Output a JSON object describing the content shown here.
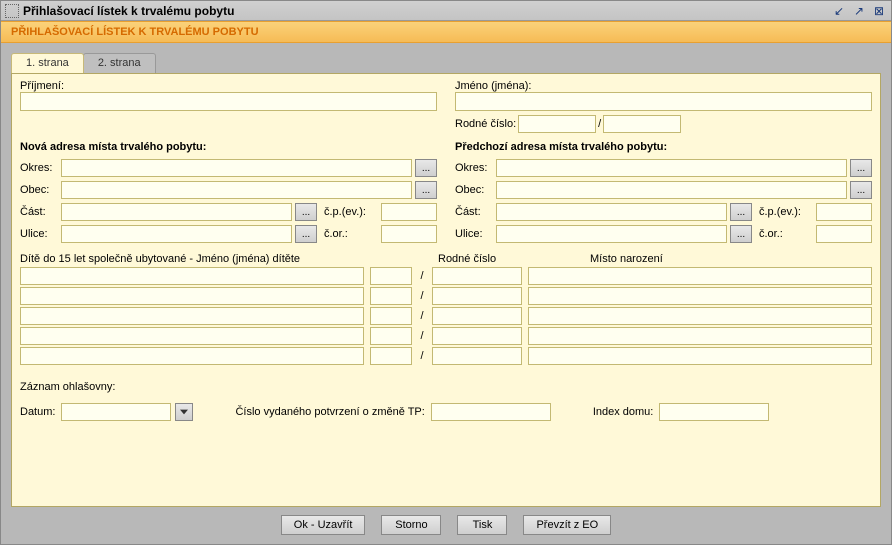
{
  "window": {
    "title": "Přihlašovací lístek k trvalému pobytu"
  },
  "band": {
    "title": "PŘIHLAŠOVACÍ LÍSTEK K TRVALÉMU POBYTU"
  },
  "tabs": {
    "t1": "1. strana",
    "t2": "2. strana"
  },
  "labels": {
    "prijmeni": "Příjmení:",
    "jmeno": "Jméno (jména):",
    "rodne_cislo": "Rodné číslo:",
    "slash": "/",
    "nova_adresa": "Nová adresa místa trvalého pobytu:",
    "predchozi_adresa": "Předchozí adresa místa trvalého pobytu:",
    "okres": "Okres:",
    "obec": "Obec:",
    "cast": "Část:",
    "cp": "č.p.(ev.):",
    "ulice": "Ulice:",
    "cor": "č.or.:",
    "ellipsis": "...",
    "dite_header": "Dítě do 15 let společně ubytované - Jméno (jména) dítěte",
    "rodne_cislo_h": "Rodné číslo",
    "misto_naroz": "Místo narození",
    "zaznam": "Záznam ohlašovny:",
    "datum": "Datum:",
    "cislo_potvrzeni": "Číslo vydaného potvrzení o změně TP:",
    "index_domu": "Index domu:"
  },
  "buttons": {
    "ok": "Ok - Uzavřít",
    "storno": "Storno",
    "tisk": "Tisk",
    "prevzit": "Převzít z EO"
  }
}
